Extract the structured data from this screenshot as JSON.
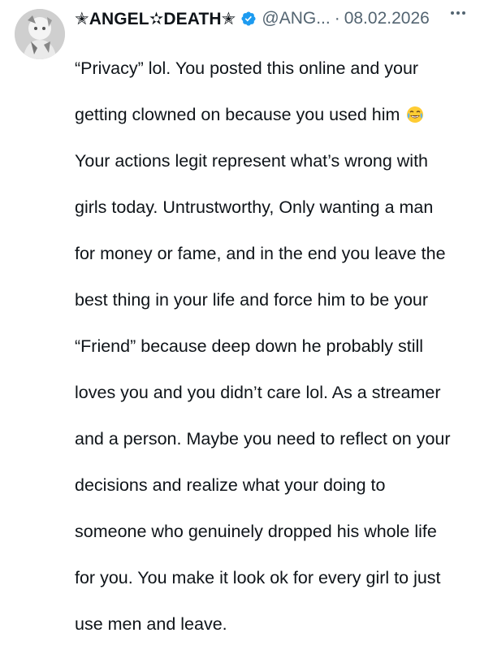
{
  "author": {
    "display_name": "✭ANGEL✫DEATH✭",
    "handle": "@ANG...",
    "separator": "·",
    "date": "08.02.2026",
    "verified": true,
    "verified_color": "#1d9bf0"
  },
  "tweet": {
    "lines": [
      "“Privacy” lol. You posted this online and your",
      "getting clowned on because you used him",
      "Your actions legit represent what’s wrong with",
      "girls today. Untrustworthy, Only wanting a man",
      "for money or fame, and in the end you leave the",
      "best thing in your life and force him to be your",
      "“Friend” because deep down he probably still",
      "loves you and you didn’t care lol. As a streamer",
      "and a person. Maybe you need to reflect on your",
      "decisions and realize what your doing to",
      "someone who genuinely dropped his whole life",
      "for you. You make it look ok for every girl to just",
      "use men and leave."
    ],
    "emoji": "laughing-tears-emoji"
  },
  "icons": {
    "more": "more-horizontal-icon",
    "verified": "verified-badge-icon"
  }
}
